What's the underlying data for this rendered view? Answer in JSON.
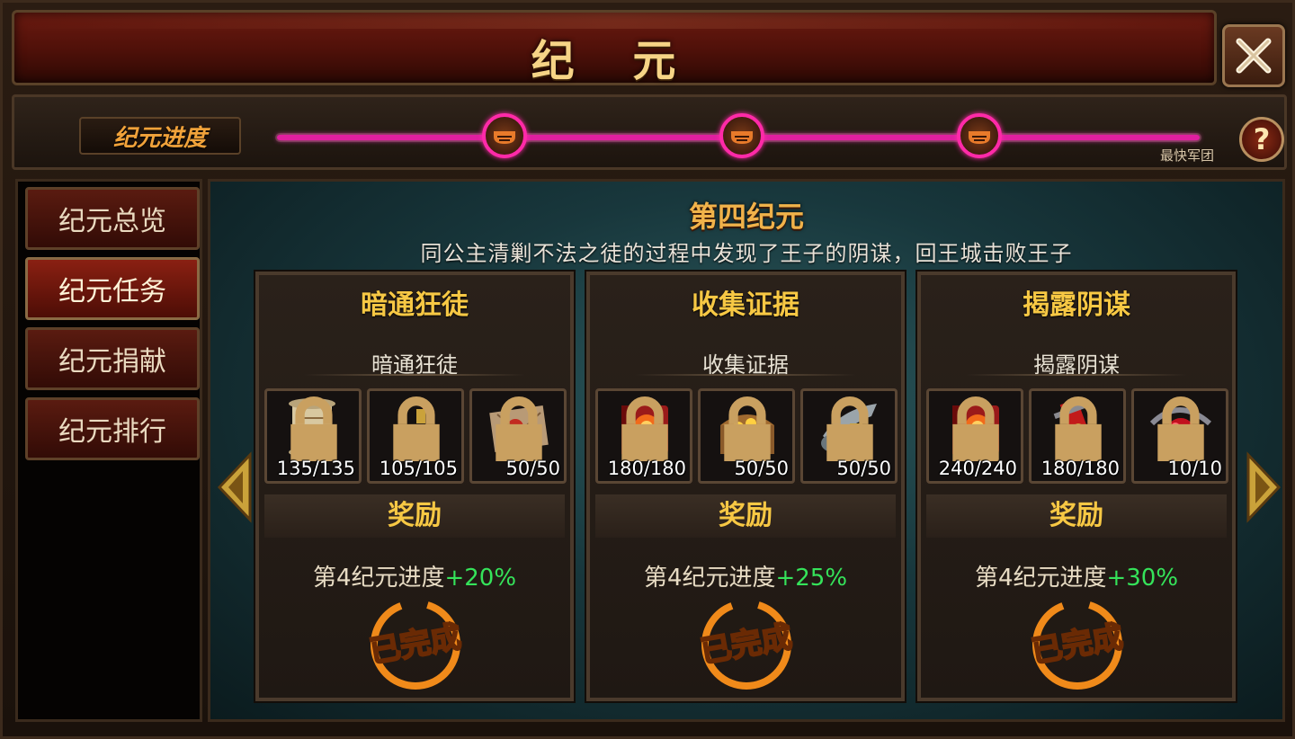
{
  "window": {
    "title": "纪 元"
  },
  "progress": {
    "label": "纪元进度",
    "fastest_label": "最快军团",
    "fill": 1.0,
    "nodes": 3
  },
  "sidebar": {
    "tabs": [
      {
        "label": "纪元总览",
        "active": false
      },
      {
        "label": "纪元任务",
        "active": true
      },
      {
        "label": "纪元捐献",
        "active": false
      },
      {
        "label": "纪元排行",
        "active": false
      }
    ]
  },
  "era": {
    "title": "第四纪元",
    "description": "同公主清剿不法之徒的过程中发现了王子的阴谋，回王城击败王子"
  },
  "cards": [
    {
      "title": "暗通狂徒",
      "subtitle": "暗通狂徒",
      "items": [
        {
          "icon": "scroll-icon",
          "count": "135/135"
        },
        {
          "icon": "potion-icon",
          "count": "105/105"
        },
        {
          "icon": "letter-icon",
          "count": "50/50"
        }
      ],
      "reward_label": "奖励",
      "reward_text": "第4纪元进度",
      "reward_pct": "+20%",
      "stamp": "已完成"
    },
    {
      "title": "收集证据",
      "subtitle": "收集证据",
      "items": [
        {
          "icon": "spellbook-icon",
          "count": "180/180"
        },
        {
          "icon": "treasure-chest-icon",
          "count": "50/50"
        },
        {
          "icon": "horn-icon",
          "count": "50/50"
        }
      ],
      "reward_label": "奖励",
      "reward_text": "第4纪元进度",
      "reward_pct": "+25%",
      "stamp": "已完成"
    },
    {
      "title": "揭露阴谋",
      "subtitle": "揭露阴谋",
      "items": [
        {
          "icon": "spellbook-icon",
          "count": "240/240"
        },
        {
          "icon": "banner-icon",
          "count": "180/180"
        },
        {
          "icon": "red-orb-icon",
          "count": "10/10"
        }
      ],
      "reward_label": "奖励",
      "reward_text": "第4纪元进度",
      "reward_pct": "+30%",
      "stamp": "已完成"
    }
  ],
  "colors": {
    "accent_gold": "#f7c844",
    "progress_pink": "#e01fa0",
    "reward_green": "#35e35a",
    "stamp_orange": "#f08a1a"
  }
}
